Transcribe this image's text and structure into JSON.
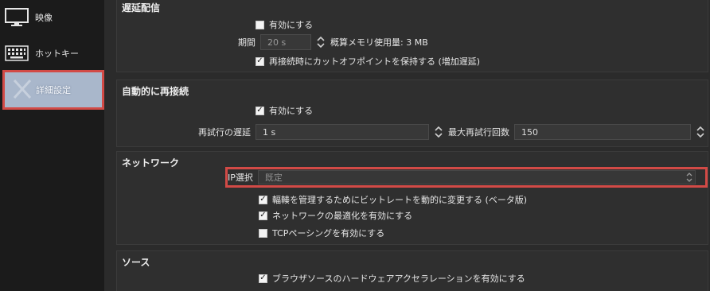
{
  "sidebar": {
    "items": [
      {
        "label": "映像",
        "icon": "monitor-icon"
      },
      {
        "label": "ホットキー",
        "icon": "keyboard-icon"
      },
      {
        "label": "詳細設定",
        "icon": "advanced-settings-icon"
      }
    ]
  },
  "delay": {
    "title": "遅延配信",
    "enable_label": "有効にする",
    "duration_label": "期間",
    "duration_value": "20 s",
    "memory_label": "概算メモリ使用量: 3 MB",
    "preserve_label": "再接続時にカットオフポイントを保持する (増加遅延)"
  },
  "reconnect": {
    "title": "自動的に再接続",
    "enable_label": "有効にする",
    "retry_delay_label": "再試行の遅延",
    "retry_delay_value": "1 s",
    "max_retries_label": "最大再試行回数",
    "max_retries_value": "150"
  },
  "network": {
    "title": "ネットワーク",
    "ip_label": "IP選択",
    "ip_value": "既定",
    "dynamic_bitrate_label": "輻輳を管理するためにビットレートを動的に変更する (ベータ版)",
    "optimize_label": "ネットワークの最適化を有効にする",
    "tcp_pacing_label": "TCPペーシングを有効にする"
  },
  "source": {
    "title": "ソース",
    "hw_accel_label": "ブラウザソースのハードウェアアクセラレーションを有効にする"
  },
  "colors": {
    "highlight_border": "#d24a46",
    "selected_sidebar": "#a9b7cb",
    "panel_bg": "#2b2b2b"
  }
}
